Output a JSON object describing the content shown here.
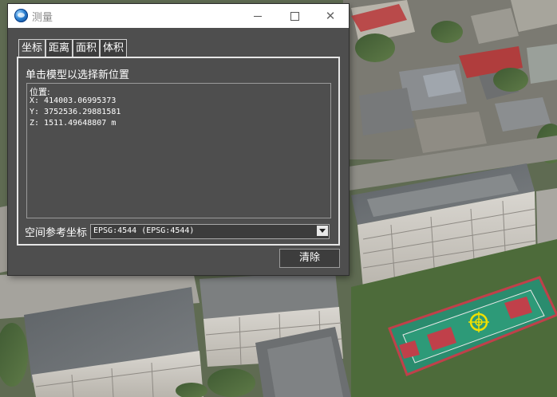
{
  "window": {
    "title": "测量",
    "title_color": "#8a8a8a",
    "icon": "globe-icon",
    "controls": [
      "minimize-icon",
      "maximize-icon",
      "close-icon"
    ],
    "close_glyph": "✕"
  },
  "tabs": [
    {
      "label": "坐标",
      "active": true
    },
    {
      "label": "距离",
      "active": false
    },
    {
      "label": "面积",
      "active": false
    },
    {
      "label": "体积",
      "active": false
    }
  ],
  "panel": {
    "hint": "单击模型以选择新位置",
    "result": {
      "heading": "位置:",
      "x": "X: 414003.06995373",
      "y": "Y: 3752536.29881581",
      "z": "Z: 1511.49648807 m"
    },
    "srs_label": "空间参考坐标",
    "srs_value": "EPSG:4544 (EPSG:4544)"
  },
  "clear_label": "清除",
  "colors": {
    "window_bg": "#4e4e4e",
    "marker": "#f0e000"
  },
  "map": {
    "marker_icon": "crosshair-icon"
  }
}
